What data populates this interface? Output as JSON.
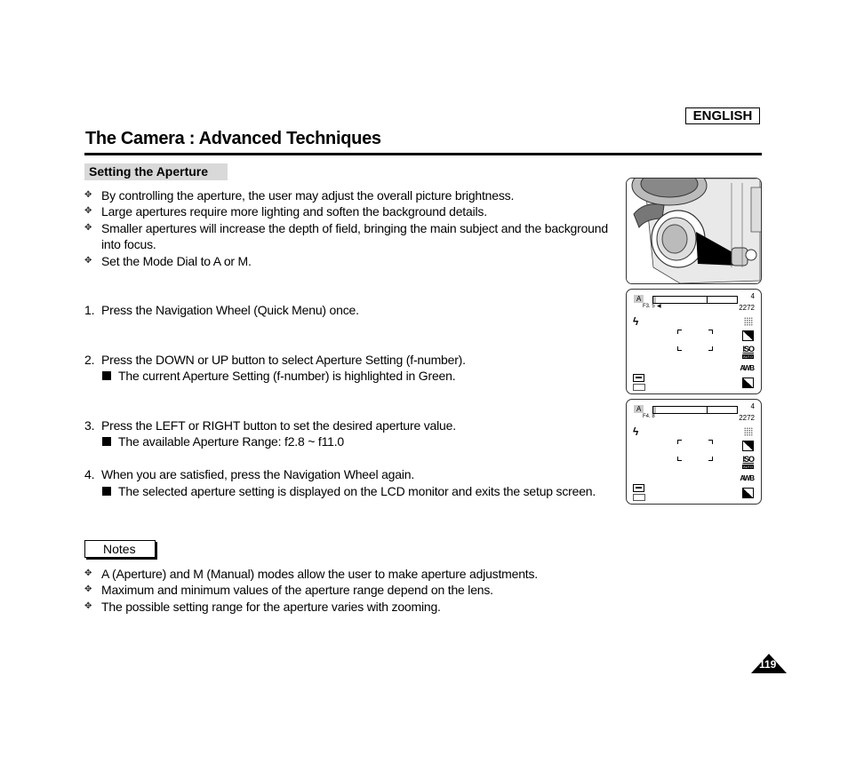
{
  "header": {
    "language_badge": "ENGLISH",
    "title": "The Camera : Advanced Techniques"
  },
  "section": {
    "heading": "Setting the Aperture",
    "intro_bullets": [
      "By controlling the aperture, the user may adjust the overall picture brightness.",
      "Large apertures require more lighting and soften the background details.",
      "Smaller apertures will increase the depth of field, bringing the main subject and the background",
      "into focus.",
      "Set the Mode Dial to A or M."
    ],
    "steps": [
      {
        "num": "1.",
        "text": "Press the Navigation Wheel (Quick Menu) once.",
        "subs": []
      },
      {
        "num": "2.",
        "text": "Press the DOWN or UP button to select Aperture Setting (f-number).",
        "subs": [
          "The current Aperture Setting (f-number) is highlighted in Green."
        ]
      },
      {
        "num": "3.",
        "text": "Press the LEFT or RIGHT button to set the desired aperture value.",
        "subs": [
          "The available Aperture Range: f2.8 ~ f11.0"
        ]
      },
      {
        "num": "4.",
        "text": "When you are satisfied, press the Navigation Wheel again.",
        "subs": [
          "The selected aperture setting is displayed on the LCD monitor and exits the setup screen."
        ]
      }
    ]
  },
  "notes": {
    "label": "Notes",
    "items": [
      "A (Aperture) and M (Manual) modes allow the user to make aperture adjustments.",
      "Maximum and minimum values of the aperture range depend on the lens.",
      "The possible setting range for the aperture varies with zooming."
    ]
  },
  "lcd_screens": [
    {
      "mode": "A",
      "aperture": "F3. 5",
      "arrow": "◀",
      "shots": "4",
      "resolution": "2272",
      "iso": "ISO",
      "iso_sub": "AUTO",
      "wb": "AWB"
    },
    {
      "mode": "A",
      "aperture": "F4. 8",
      "arrow": "",
      "shots": "4",
      "resolution": "2272",
      "iso": "ISO",
      "iso_sub": "AUTO",
      "wb": "AWB"
    }
  ],
  "icons": {
    "bullet": "✥",
    "flash": "ϟ"
  },
  "page_number": "119"
}
